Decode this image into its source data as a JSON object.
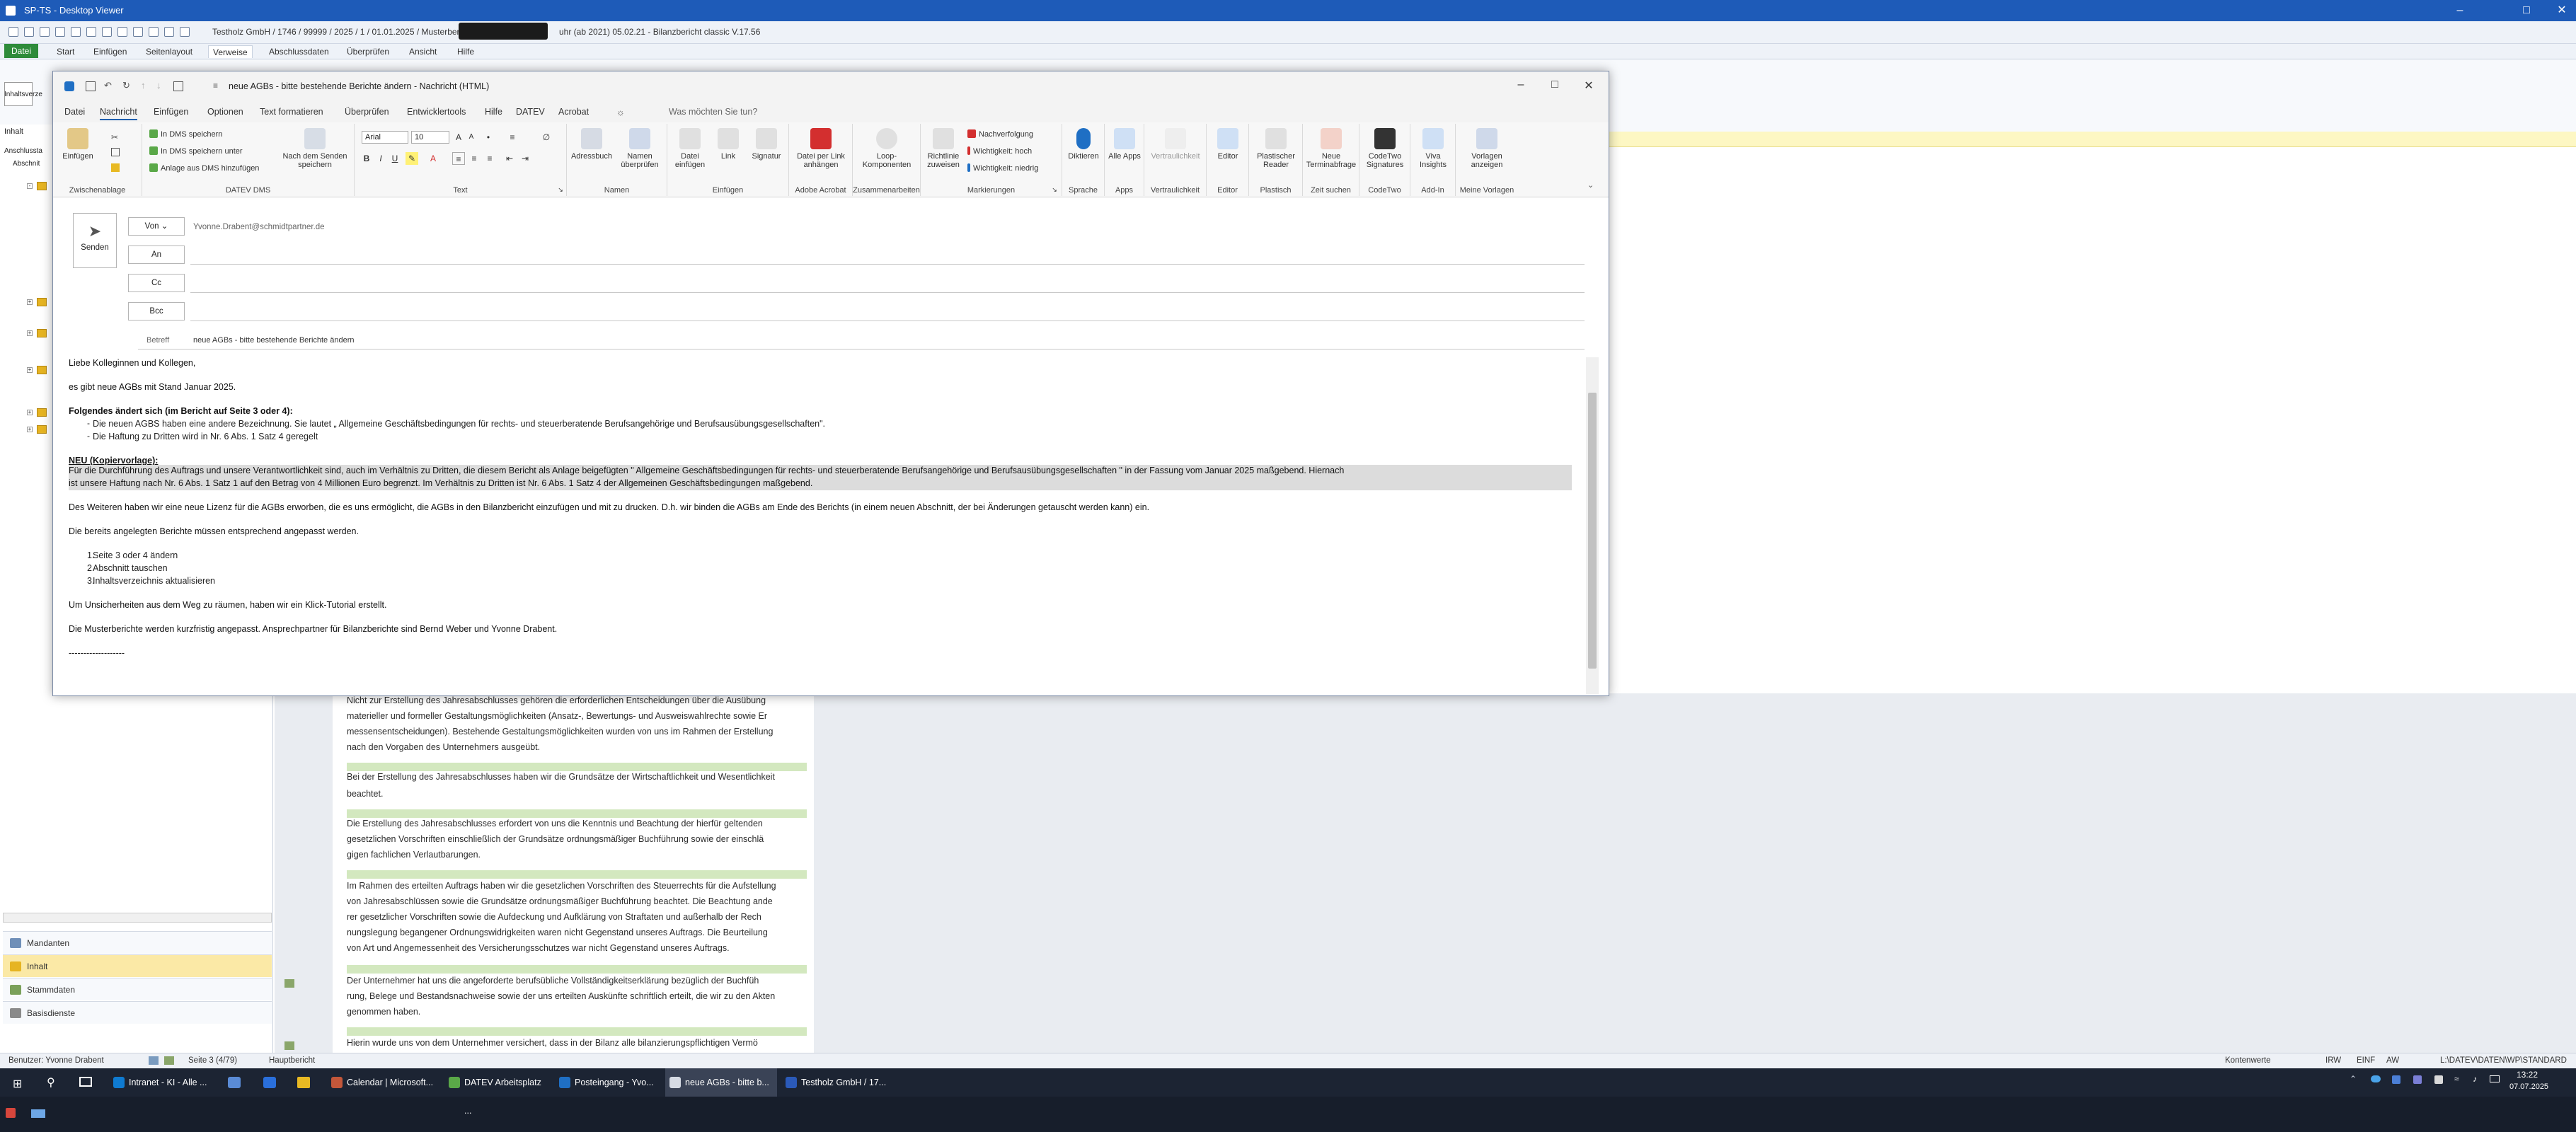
{
  "outer_app": {
    "title": "SP-TS - Desktop Viewer",
    "path": "Testholz GmbH / 1746 / 99999 / 2025 / 1 / 01.01.2025 / Musterbericht",
    "path_tail": "uhr (ab 2021) 05.02.21 - Bilanzbericht classic V.17.56",
    "tabs": [
      "Datei",
      "Start",
      "Einfügen",
      "Seitenlayout",
      "Verweise",
      "Abschlussdaten",
      "Überprüfen",
      "Ansicht",
      "Hilfe"
    ],
    "active_tab": "Verweise",
    "left_pane_title": "Inhalt",
    "left_pane_sub": "Inhaltsverze",
    "tree_header": "Anschlussta",
    "tree_item_label": "Abschnit",
    "nav": [
      "Mandanten",
      "Inhalt",
      "Stammdaten",
      "Basisdienste"
    ]
  },
  "mail": {
    "title": "neue AGBs - bitte bestehende Berichte ändern  -  Nachricht (HTML)",
    "tabs": [
      "Datei",
      "Nachricht",
      "Einfügen",
      "Optionen",
      "Text formatieren",
      "Überprüfen",
      "Entwicklertools",
      "Hilfe",
      "DATEV",
      "Acrobat"
    ],
    "active_tab": "Nachricht",
    "search_placeholder": "Was möchten Sie tun?",
    "ribbon": {
      "groups": [
        "Zwischenablage",
        "DATEV DMS",
        "Text",
        "Namen",
        "Einfügen",
        "Adobe Acrobat",
        "Zusammenarbeiten",
        "Markierungen",
        "Sprache",
        "Apps",
        "Vertraulichkeit",
        "Editor",
        "Plastisch",
        "Zeit suchen",
        "CodeTwo",
        "Add-In",
        "Meine Vorlagen"
      ],
      "einfuegen": "Einfügen",
      "dms": [
        "In DMS speichern",
        "In DMS speichern unter",
        "Anlage aus DMS hinzufügen"
      ],
      "nach_dem_senden": "Nach dem Senden speichern",
      "font_name": "Arial",
      "font_size": "10",
      "adressbuch": "Adressbuch",
      "namen_ueberpruefen": "Namen überprüfen",
      "datei_einfuegen": "Datei einfügen",
      "link": "Link",
      "signatur": "Signatur",
      "datei_pdf": "Datei per Link anhängen",
      "loop": "Loop-Komponenten",
      "richtlinie": "Richtlinie zuweisen",
      "nachverfolgung": "Nachverfolgung",
      "wichtig_hoch": "Wichtigkeit: hoch",
      "wichtig_niedrig": "Wichtigkeit: niedrig",
      "diktieren": "Diktieren",
      "alle_apps": "Alle Apps",
      "vertraulichkeit": "Vertraulichkeit",
      "editor": "Editor",
      "plastischer_reader": "Plastischer Reader",
      "neue_terminabfrage": "Neue Terminabfrage",
      "codetwo": "CodeTwo Signatures",
      "viva": "Viva Insights",
      "vorlagen": "Vorlagen anzeigen"
    },
    "header": {
      "send": "Senden",
      "from_btn": "Von",
      "to_btn": "An",
      "cc_btn": "Cc",
      "bcc_btn": "Bcc",
      "from_addr": "Yvonne.Drabent@schmidtpartner.de",
      "subject_label": "Betreff",
      "subject": "neue AGBs - bitte bestehende Berichte ändern"
    },
    "body": {
      "greeting": "Liebe Kolleginnen und Kollegen,",
      "p1": "es gibt neue AGBs mit Stand Januar 2025.",
      "changes_heading": "Folgendes ändert sich (im Bericht auf Seite 3 oder 4):",
      "bullets": [
        "Die neuen AGBS haben eine andere Bezeichnung. Sie lautet „ Allgemeine Geschäftsbedingungen für rechts- und steuerberatende Berufsangehörige und Berufsausübungsgesellschaften\".",
        "Die Haftung zu Dritten wird in Nr. 6 Abs. 1 Satz 4 geregelt"
      ],
      "new_heading": "NEU (Kopiervorlage):",
      "new_line1": "Für die Durchführung des Auftrags und unsere Verantwortlichkeit sind, auch im Verhältnis zu Dritten, die diesem Bericht als Anlage beigefügten \" Allgemeine Geschäftsbedingungen für rechts- und steuerberatende Berufsangehörige und Berufsausübungsgesellschaften \" in der Fassung vom Januar 2025 maßgebend. Hiernach",
      "new_line2": "ist unsere Haftung nach Nr. 6 Abs. 1 Satz 1 auf den Betrag von 4 Millionen Euro begrenzt. Im Verhältnis zu Dritten ist Nr. 6 Abs. 1 Satz 4 der Allgemeinen Geschäftsbedingungen maßgebend.",
      "p2": "Des Weiteren haben wir eine neue Lizenz für die AGBs erworben, die es uns ermöglicht, die AGBs in den Bilanzbericht einzufügen und mit zu drucken. D.h. wir binden die AGBs am Ende des Berichts (in einem neuen Abschnitt, der bei Änderungen getauscht werden kann) ein.",
      "p3": "Die bereits angelegten Berichte müssen entsprechend angepasst werden.",
      "steps": [
        "Seite 3 oder 4 ändern",
        "Abschnitt tauschen",
        "Inhaltsverzeichnis aktualisieren"
      ],
      "p4": "Um Unsicherheiten aus dem Weg zu räumen, haben wir ein Klick-Tutorial erstellt.",
      "p5": "Die Musterberichte werden kurzfristig angepasst. Ansprechpartner für Bilanzberichte sind Bernd Weber und Yvonne Drabent.",
      "sig_line": "-------------------"
    }
  },
  "document": {
    "paras": [
      "Nicht zur Erstellung des Jahresabschlusses gehören die erforderlichen Entscheidungen über die Ausübung",
      "materieller und formeller Gestaltungsmöglichkeiten (Ansatz-, Bewertungs- und Ausweiswahlrechte sowie Er",
      "messensentscheidungen). Bestehende Gestaltungsmöglichkeiten wurden von uns im Rahmen der Erstellung",
      "nach den Vorgaben des Unternehmers ausgeübt.",
      "Bei der Erstellung des Jahresabschlusses haben wir die Grundsätze der Wirtschaftlichkeit und Wesentlichkeit",
      "beachtet.",
      "Die Erstellung des Jahresabschlusses erfordert von uns die Kenntnis und Beachtung der hierfür geltenden",
      "gesetzlichen Vorschriften einschließlich der Grundsätze ordnungsmäßiger Buchführung sowie der einschlä",
      "gigen fachlichen Verlautbarungen.",
      "Im Rahmen des erteilten Auftrags haben wir die gesetzlichen Vorschriften des Steuerrechts für die Aufstellung",
      "von Jahresabschlüssen sowie die Grundsätze ordnungsmäßiger Buchführung beachtet. Die Beachtung ande",
      "rer gesetzlicher Vorschriften sowie die Aufdeckung und Aufklärung von Straftaten und außerhalb der Rech",
      "nungslegung begangener Ordnungswidrigkeiten waren nicht Gegenstand unseres Auftrags. Die Beurteilung",
      "von Art und Angemessenheit des Versicherungsschutzes war nicht Gegenstand unseres Auftrags.",
      "Der Unternehmer hat uns die angeforderte berufsübliche Vollständigkeitserklärung bezüglich der Buchfüh",
      "rung, Belege und Bestandsnachweise sowie der uns erteilten Auskünfte schriftlich erteilt, die wir zu den Akten",
      "genommen haben.",
      "Hierin wurde uns von dem Unternehmer versichert, dass in der Bilanz alle bilanzierungspflichtigen Vermö"
    ]
  },
  "statusbar": {
    "user": "Benutzer: Yvonne Drabent",
    "page": "Seite 3 (4/79)",
    "section": "Hauptbericht",
    "kontenwerte": "Kontenwerte",
    "irw": "IRW",
    "einf": "EINF",
    "aw": "AW",
    "path": "L:\\DATEV\\DATEN\\WP\\STANDARD"
  },
  "taskbar": {
    "items": [
      "Intranet - KI - Alle ...",
      "Calendar | Microsoft...",
      "DATEV Arbeitsplatz ...",
      "Posteingang - Yvo...",
      "neue AGBs - bitte b...",
      "Testholz GmbH / 17..."
    ],
    "time": "13:22",
    "date": "07.07.2025"
  },
  "colors": {
    "accent": "#1f5fae",
    "datei_green": "#2e8b3a",
    "highlight": "#dcdcdc",
    "doc_band": "#d3e8bf"
  }
}
